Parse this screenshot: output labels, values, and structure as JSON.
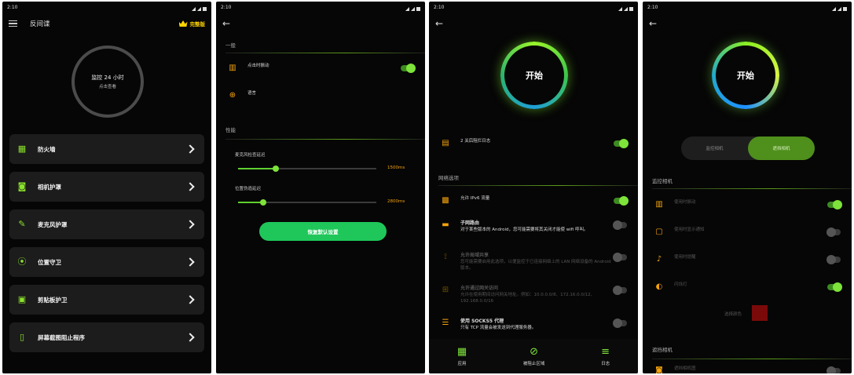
{
  "status_time": "2:10",
  "s1": {
    "title": "反间谍",
    "premium": "完整版",
    "ring_line1": "监控 24 小时",
    "ring_line2": "点击查看",
    "cards": [
      "防火墙",
      "相机护罩",
      "麦克风护罩",
      "位置守卫",
      "剪贴板护卫",
      "屏幕截图阻止程序"
    ]
  },
  "s2": {
    "section_general": "一般",
    "vibrate": "点击时振动",
    "language": "语言",
    "section_perf": "性能",
    "mic_delay_label": "麦克风检查延迟",
    "mic_delay_value": "1500ms",
    "mic_delay_fraction": 0.27,
    "loc_delay_label": "位置伪造延迟",
    "loc_delay_value": "2800ms",
    "loc_delay_fraction": 0.18,
    "reset_button": "恢复默认设置"
  },
  "s3": {
    "start": "开始",
    "blocked": "2 关后阻拦日志",
    "section_network": "网络选项",
    "ipv6": "允许 IPv6 流量",
    "subnet_title": "子网路由",
    "subnet_desc": "对于某些版本的 Android，您可能需要将其关闭才能使 wifi 呼叫。",
    "lan_title": "允许局域共享",
    "lan_desc": "您可能需要启用此选项，以便监控于已连接网络上的 LAN 网络设备的 Android 版本。",
    "dns_title": "允许通过网关访问",
    "dns_desc": "允许在使用期间访问网关地址。例如：10.0.0.0/8、172.16.0.0/12、192.168.0.0/16",
    "socks_title": "使用 SOCKS5 代理",
    "socks_desc": "只有 TCP 流量会被发送到代理服务器。",
    "nav": [
      "应用",
      "被阻止区域",
      "日志"
    ]
  },
  "s4": {
    "start": "开始",
    "tab_monitor": "监控相机",
    "tab_block": "遮挡相机",
    "section_monitor": "监控相机",
    "vibrate": "使用时振动",
    "notify": "使用时显示通知",
    "sound": "使用时提醒",
    "flash": "闪烁灯",
    "color_label": "选择颜色",
    "section_block": "遮挡相机",
    "block_item": "遮挡相机图"
  },
  "colors": {
    "accent": "#7ee33a",
    "orange": "#f2a20d",
    "gold": "#ffd400",
    "button": "#1fc75a"
  }
}
